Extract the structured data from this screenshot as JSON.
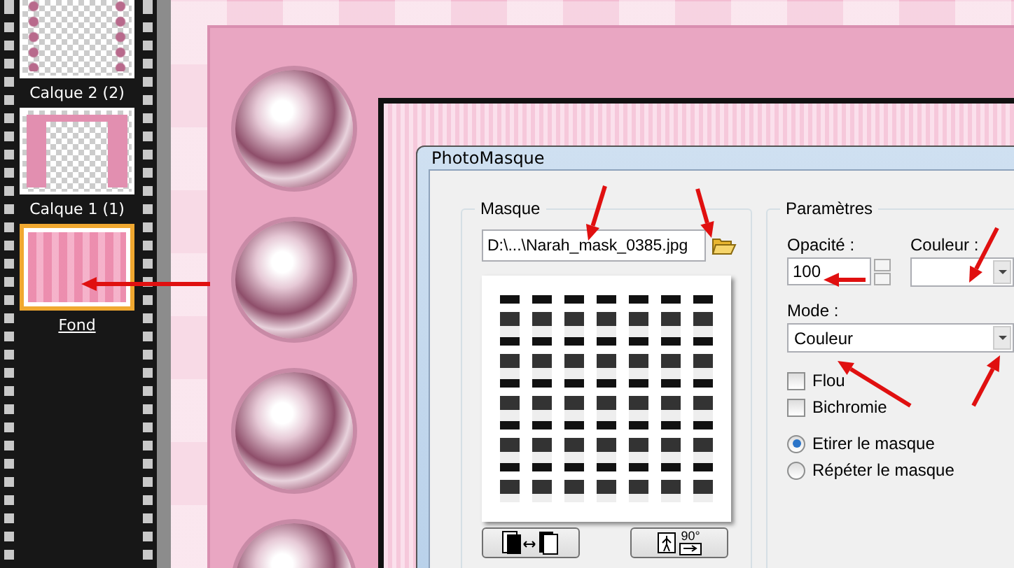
{
  "layers": [
    {
      "name": "Calque 2 (2)",
      "kind": "beads",
      "selected": false
    },
    {
      "name": "Calque 1 (1)",
      "kind": "frame",
      "selected": false
    },
    {
      "name": "Fond",
      "kind": "pattern",
      "selected": true
    }
  ],
  "dialog": {
    "title": "PhotoMasque",
    "mask_group": {
      "label": "Masque",
      "file_path": "D:\\...\\Narah_mask_0385.jpg",
      "buttons": [
        {
          "kind": "swap"
        },
        {
          "kind": "rotate",
          "label": "90°"
        }
      ]
    },
    "parameters": {
      "label": "Paramètres",
      "opacity": {
        "label": "Opacité :",
        "value": "100"
      },
      "color": {
        "label": "Couleur :"
      },
      "mode": {
        "label": "Mode :",
        "value": "Couleur"
      },
      "checkboxes": [
        {
          "label": "Flou",
          "checked": false
        },
        {
          "label": "Bichromie",
          "checked": false
        }
      ],
      "radios": [
        {
          "label": "Etirer le masque",
          "selected": true
        },
        {
          "label": "Répéter le masque",
          "selected": false
        }
      ]
    }
  }
}
